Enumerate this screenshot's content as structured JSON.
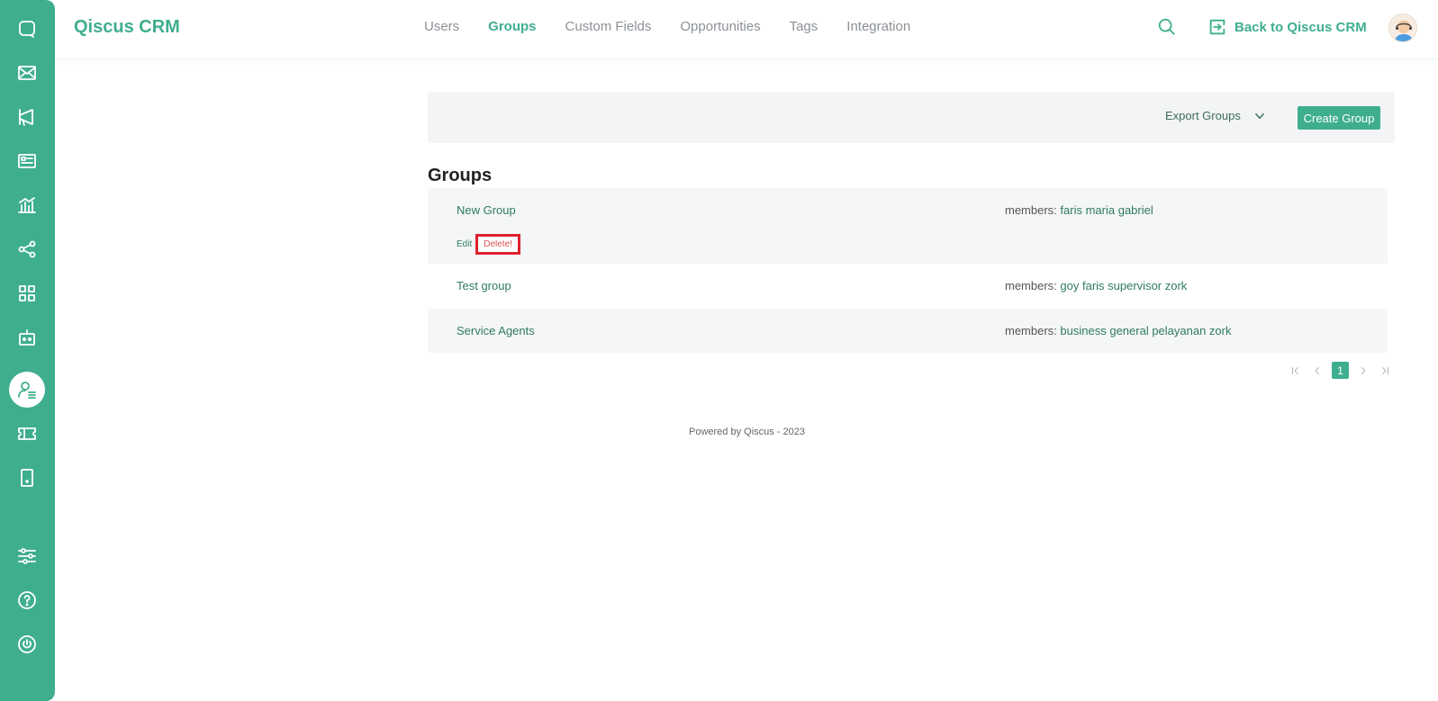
{
  "brand": {
    "name": "Qiscus CRM",
    "color": "#3fae8f"
  },
  "sidebar": {
    "items": [
      {
        "icon": "chat-icon",
        "active": false
      },
      {
        "icon": "mail-icon",
        "active": false
      },
      {
        "icon": "megaphone-icon",
        "active": false
      },
      {
        "icon": "contact-card-icon",
        "active": false
      },
      {
        "icon": "analytics-icon",
        "active": false
      },
      {
        "icon": "share-nodes-icon",
        "active": false
      },
      {
        "icon": "apps-grid-icon",
        "active": false
      },
      {
        "icon": "bot-icon",
        "active": false
      },
      {
        "icon": "agent-management-icon",
        "active": true
      },
      {
        "icon": "ticket-icon",
        "active": false
      },
      {
        "icon": "mobile-icon",
        "active": false
      },
      {
        "icon": "settings-sliders-icon",
        "active": false
      },
      {
        "icon": "help-icon",
        "active": false
      },
      {
        "icon": "power-icon",
        "active": false
      }
    ]
  },
  "nav": {
    "items": [
      "Users",
      "Groups",
      "Custom Fields",
      "Opportunities",
      "Tags",
      "Integration"
    ],
    "active": "Groups"
  },
  "header": {
    "back_label": "Back to Qiscus CRM"
  },
  "toolbar": {
    "export_label": "Export Groups",
    "create_label": "Create Group"
  },
  "groups": {
    "title": "Groups",
    "rows": [
      {
        "name": "New Group",
        "members_label": "members:",
        "members": "faris maria gabriel",
        "edit_label": "Edit",
        "delete_label": "Delete!"
      },
      {
        "name": "Test group",
        "members_label": "members:",
        "members": "goy faris supervisor zork"
      },
      {
        "name": "Service Agents",
        "members_label": "members:",
        "members": "business general pelayanan zork"
      }
    ]
  },
  "pagination": {
    "current_page": "1"
  },
  "footer": {
    "text": "Powered by Qiscus - 2023"
  }
}
